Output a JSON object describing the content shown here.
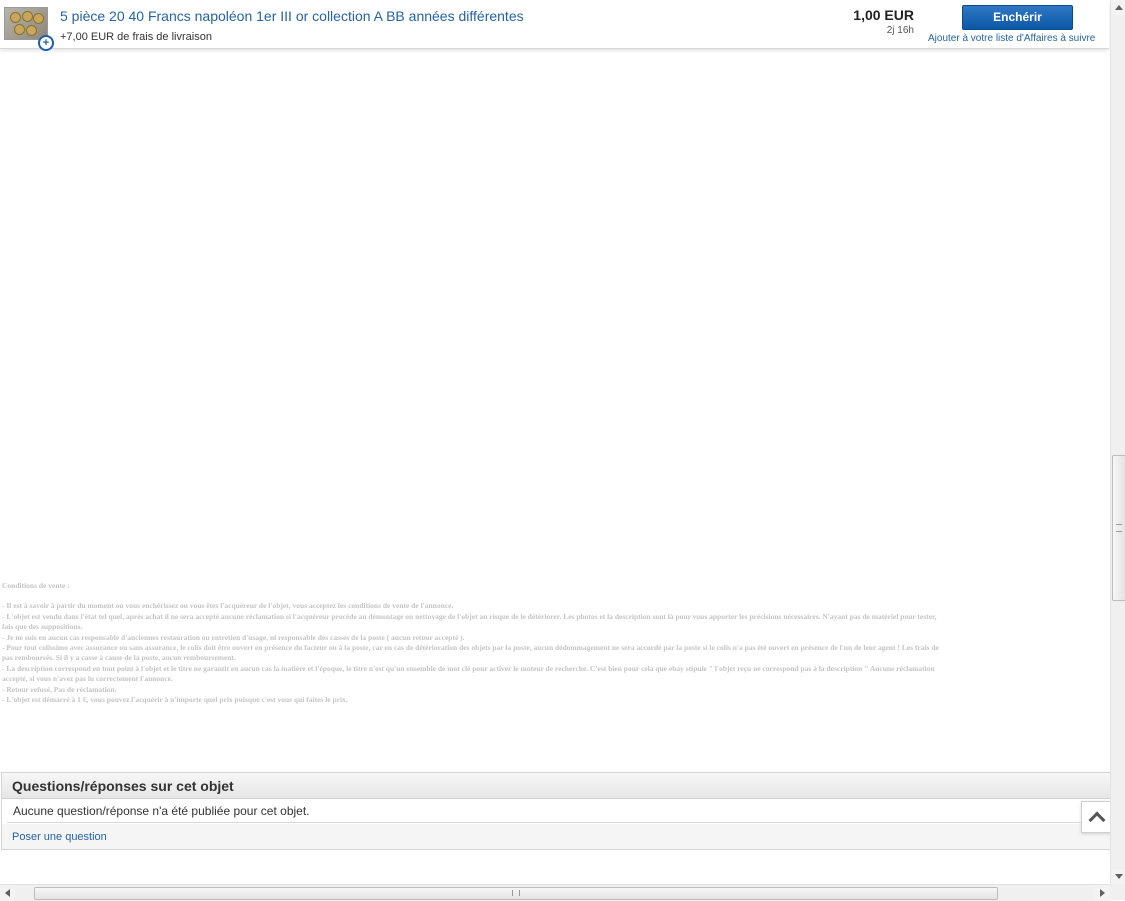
{
  "header": {
    "title": "5 pièce 20 40 Francs napoléon 1er III or collection A BB années différentes",
    "shipping": "+7,00 EUR de frais de livraison",
    "price": "1,00 EUR",
    "time_left": "2j 16h",
    "bid_label": "Enchérir",
    "watch_label": "Ajouter à votre liste d'Affaires à suivre"
  },
  "conditions": {
    "title": "Conditions de vente :",
    "lines": [
      "- Il est à savoir à partir du moment ou vous enchérissez ou vous êtes l'acquéreur de l'objet, vous acceptez les conditions de vente de l'annonce.",
      "- L'objet est vendu dans l'état tel quel, après achat il ne sera accepté aucune réclamation si l'acquéreur procède au démontage ou nettoyage de l'objet au risque de le détériorer. Les photos et la description sont là pour vous apporter les précisions nécessaires. N'ayant pas de matériel pour tester,",
      "fais que des suppositions.",
      "- Je ne suis en aucun cas responsable d'anciennes restauration ou entretien d'usage, ni responsable des casses de la poste ( aucun retour accepté ).",
      "- Pour tout colissimo avec assurance ou sans assurance, le colis doit être ouvert en présence du facteur ou à la poste, car en cas de détérioration des objets par la poste, aucun dédommagement ne sera accordé par la poste si le colis n'a pas été ouvert en présence de l'un de leur agent ! Les frais de",
      "pas remboursés. Si il y a casse à cause de la poste, aucun remboursement.",
      "- La description correspond en tout point à l'objet et le titre ne garantit en aucun cas la matière et l'époque, le titre n'est qu'un ensemble de mot clé pour activer le moteur de recherche. C'est bien pour cela que ebay stipule \" l'objet reçu ne correspond pas à la description \" Aucune réclamation",
      "accepté, si vous n'avez pas lu correctement l'annonce.",
      "- Retour refusé, Pas de réclamation.",
      "- L'objet est démarré à 1 €, vous pouvez l'acquérir à n'importe quel prix puisque c'est vous qui faites le prix."
    ]
  },
  "qa": {
    "heading": "Questions/réponses sur cet objet",
    "empty_message": "Aucune question/réponse n'a été publiée pour cet objet.",
    "ask_label": "Poser une question"
  },
  "icons": {
    "zoom": "zoom-in-icon",
    "back_to_top": "chevron-up-icon"
  },
  "colors": {
    "link": "#2463a8",
    "bid_button": "#0b57a7",
    "conditions_text": "#c4c4c4"
  }
}
